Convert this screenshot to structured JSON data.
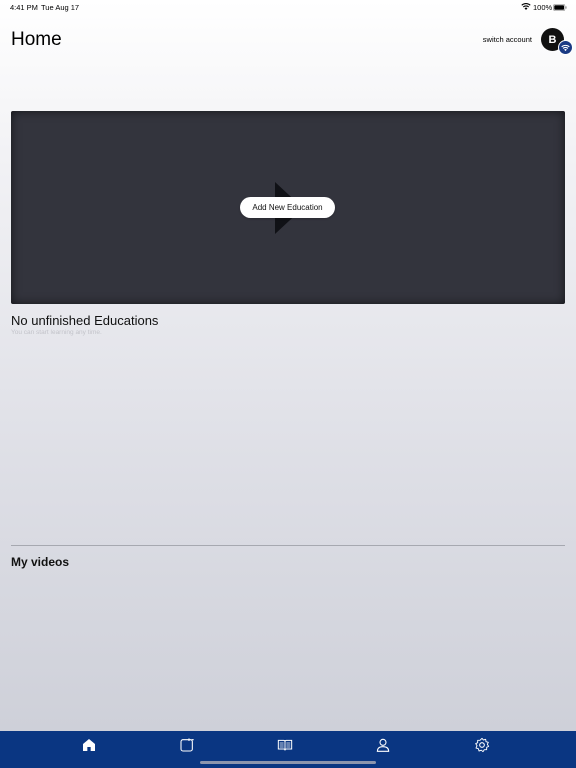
{
  "status_bar": {
    "time": "4:41 PM",
    "date": "Tue Aug 17",
    "battery_percent": "100%",
    "wifi_icon": "wifi-icon",
    "battery_icon": "battery-icon"
  },
  "header": {
    "title": "Home",
    "switch_account_label": "switch account",
    "avatar_initial": "B",
    "avatar_badge_icon": "wifi-badge-icon"
  },
  "featured": {
    "play_icon": "play-icon",
    "add_button_label": "Add New Education"
  },
  "unfinished": {
    "heading": "No unfinished Educations",
    "subtext": "You can start learning any time."
  },
  "my_videos": {
    "heading": "My videos"
  },
  "tab_bar": {
    "tabs": [
      {
        "icon": "home-icon",
        "active": true
      },
      {
        "icon": "calendar-icon",
        "active": false
      },
      {
        "icon": "book-icon",
        "active": false
      },
      {
        "icon": "profile-icon",
        "active": false
      },
      {
        "icon": "settings-icon",
        "active": false
      }
    ]
  },
  "colors": {
    "tab_bar": "#0a3682",
    "video_card": "#33343d"
  }
}
